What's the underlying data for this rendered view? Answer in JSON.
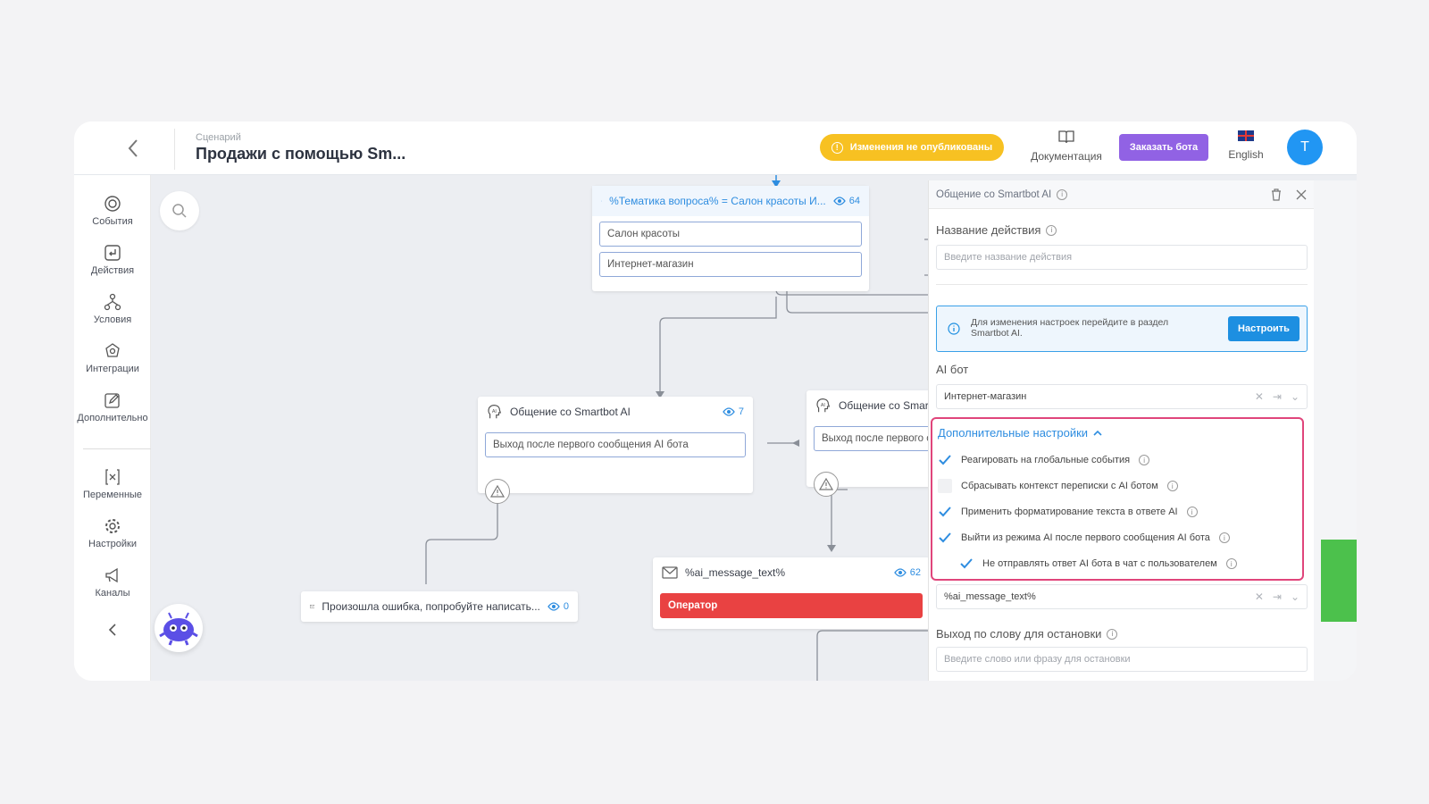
{
  "header": {
    "scenario_label": "Сценарий",
    "scenario_title": "Продажи с помощью Sm...",
    "unpublished_warning": "Изменения не опубликованы",
    "docs_label": "Документация",
    "order_bot_label": "Заказать бота",
    "language_label": "English",
    "avatar_initial": "T"
  },
  "sidebar": {
    "items": [
      {
        "label": "События",
        "icon": "target-icon"
      },
      {
        "label": "Действия",
        "icon": "action-icon"
      },
      {
        "label": "Условия",
        "icon": "branch-icon"
      },
      {
        "label": "Интеграции",
        "icon": "integration-icon"
      },
      {
        "label": "Дополнительно",
        "icon": "edit-icon"
      },
      {
        "label": "Переменные",
        "icon": "variable-icon"
      },
      {
        "label": "Настройки",
        "icon": "gear-icon"
      },
      {
        "label": "Каналы",
        "icon": "megaphone-icon"
      }
    ]
  },
  "canvas": {
    "condition_node": {
      "title": "%Тематика вопроса% = Салон красоты И...",
      "views": "64",
      "options": [
        "Салон красоты",
        "Интернет-магазин"
      ]
    },
    "ai_node_left": {
      "title": "Общение со Smartbot AI",
      "views": "7",
      "button": "Выход после первого сообщения AI бота"
    },
    "ai_node_right": {
      "title": "Общение со Smartbot AI",
      "button": "Выход после первого сообщения AI бота"
    },
    "message_node": {
      "title": "%ai_message_text%",
      "views": "62",
      "button": "Оператор"
    },
    "error_node": {
      "title": "Произошла ошибка, попробуйте написать...",
      "views": "0"
    }
  },
  "panel": {
    "title": "Общение со Smartbot AI",
    "action_name_label": "Название действия",
    "action_name_placeholder": "Введите название действия",
    "notice_text": "Для изменения настроек перейдите в раздел Smartbot AI.",
    "notice_button": "Настроить",
    "ai_bot_label": "AI бот",
    "ai_bot_value": "Интернет-магазин",
    "advanced_title": "Дополнительные настройки",
    "options": [
      {
        "label": "Реагировать на глобальные события",
        "checked": true
      },
      {
        "label": "Сбрасывать контекст переписки с AI ботом",
        "checked": false
      },
      {
        "label": "Применить форматирование текста в ответе AI",
        "checked": true
      },
      {
        "label": "Выйти из режима AI после первого сообщения AI бота",
        "checked": true
      },
      {
        "label": "Не отправлять ответ AI бота в чат с пользователем",
        "checked": true
      }
    ],
    "message_var_value": "%ai_message_text%",
    "stop_word_label": "Выход по слову для остановки",
    "stop_word_placeholder": "Введите слово или фразу для остановки"
  },
  "colors": {
    "accent_blue": "#2e8de0",
    "warning_yellow": "#f7c122",
    "order_purple": "#9162e4",
    "highlight_pink": "#e0457b",
    "operator_red": "#e94242"
  }
}
